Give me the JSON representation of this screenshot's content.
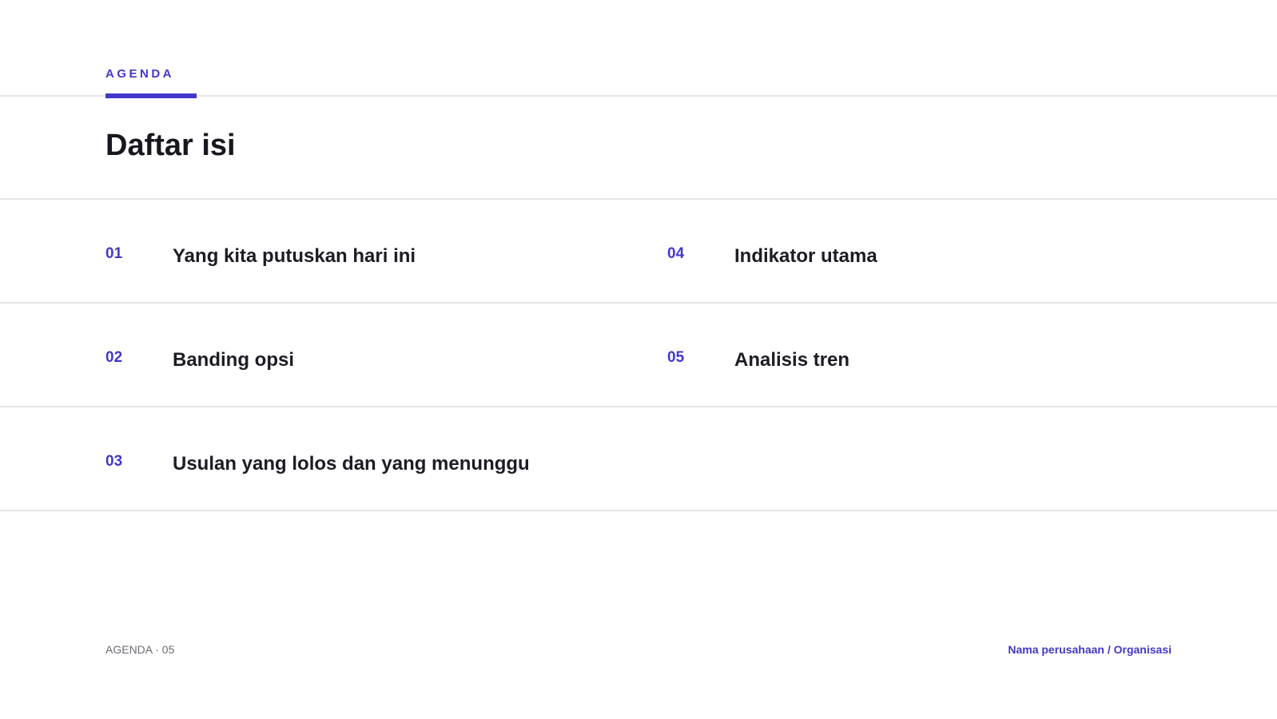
{
  "header": {
    "section_label": "AGENDA",
    "title": "Daftar isi"
  },
  "agenda": {
    "items": [
      {
        "number": "01",
        "label": "Yang kita putuskan hari ini"
      },
      {
        "number": "02",
        "label": "Banding opsi"
      },
      {
        "number": "03",
        "label": "Usulan yang lolos dan yang menunggu"
      },
      {
        "number": "04",
        "label": "Indikator utama"
      },
      {
        "number": "05",
        "label": "Analisis tren"
      }
    ]
  },
  "footer": {
    "left": "AGENDA · 05",
    "right": "Nama perusahaan / Organisasi"
  },
  "colors": {
    "accent": "#4338ca",
    "text": "#17171f",
    "muted": "#6b6b75",
    "rule": "#e6e6e9"
  }
}
